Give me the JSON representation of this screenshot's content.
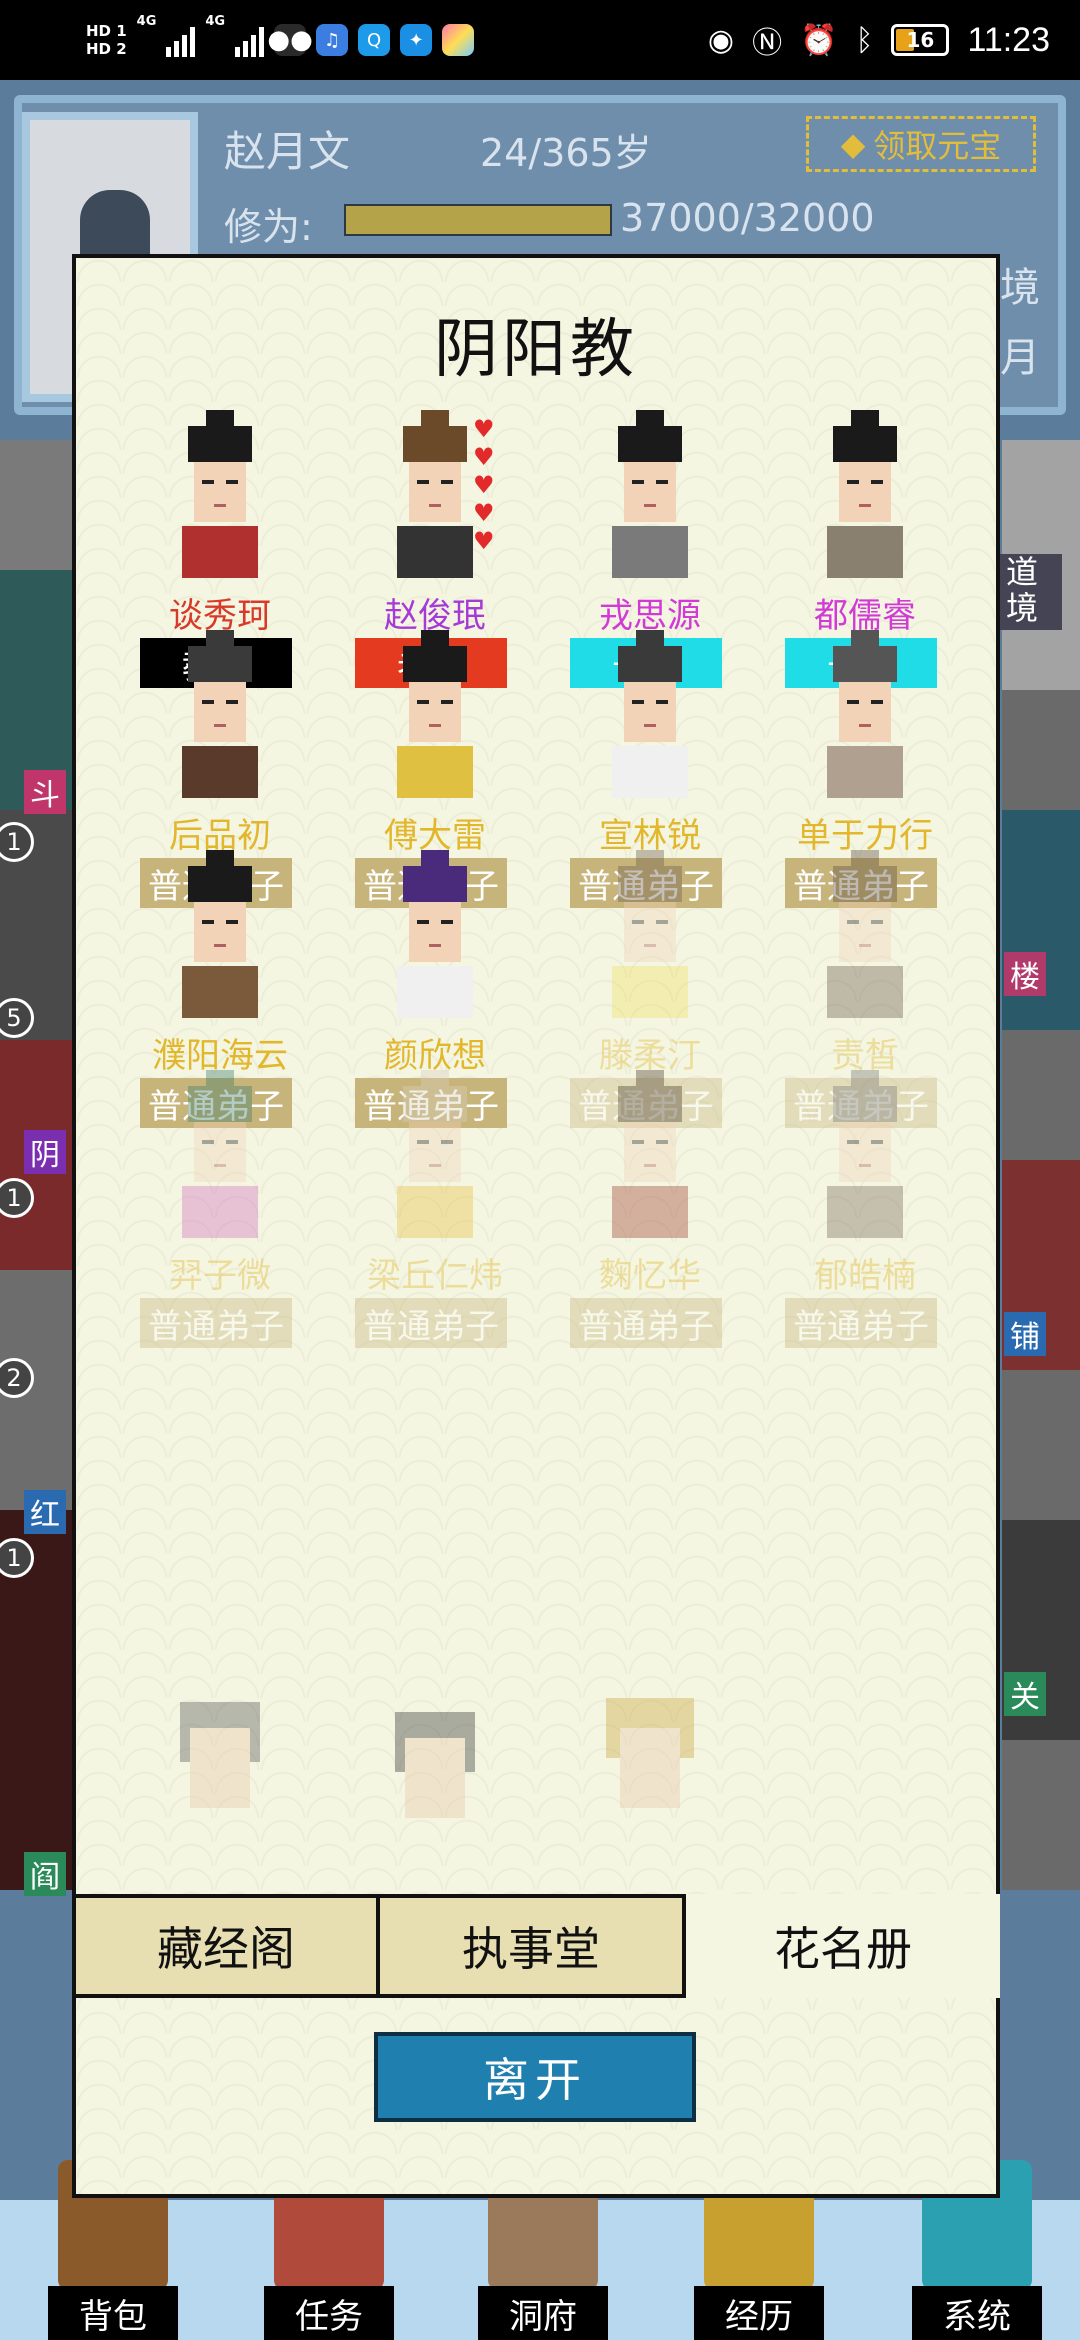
{
  "status_bar": {
    "hd1": "HD 1",
    "hd2": "HD 2",
    "net1": "4G",
    "net2": "4G",
    "battery": "16",
    "time": "11:23",
    "icons": [
      "wechat-icon",
      "music-icon",
      "search-app-icon",
      "bulb-icon",
      "gallery-icon",
      "eye-icon",
      "nfc-icon",
      "alarm-icon",
      "bluetooth-icon"
    ]
  },
  "profile": {
    "name": "赵月文",
    "age": "24/365岁",
    "claim_button": "领取元宝",
    "cultivation_label": "修为:",
    "cultivation_value": "37000/32000",
    "cultivation_fill": 1.0,
    "realm_peek": "境",
    "month_peek": "月"
  },
  "side": {
    "badges": [
      "1",
      "5",
      "1",
      "2",
      "1"
    ],
    "tags_left": [
      "斗",
      "阴",
      "红",
      "阎"
    ],
    "tags_right": [
      "道境",
      "楼",
      "铺",
      "关"
    ]
  },
  "modal": {
    "title": "阴阳教",
    "members": [
      {
        "name": "谈秀珂",
        "rank": "教主",
        "name_color": "#d83a2a",
        "rank_bg": "#000000",
        "dim": false
      },
      {
        "name": "赵俊珉",
        "rank": "老祖",
        "name_color": "#a63ad6",
        "rank_bg": "#e43a20",
        "dim": false,
        "hearts": 5
      },
      {
        "name": "戎思源",
        "rank": "长老",
        "name_color": "#d23ad6",
        "rank_bg": "#1fdce6",
        "dim": false
      },
      {
        "name": "都儒睿",
        "rank": "长老",
        "name_color": "#d23ad6",
        "rank_bg": "#1fdce6",
        "dim": false
      },
      {
        "name": "后品初",
        "rank": "普通弟子",
        "name_color": "#e2b72c",
        "rank_bg": "#c7b47a",
        "dim": false
      },
      {
        "name": "傅大雷",
        "rank": "普通弟子",
        "name_color": "#e2b72c",
        "rank_bg": "#c7b47a",
        "dim": false
      },
      {
        "name": "宣林锐",
        "rank": "普通弟子",
        "name_color": "#e2b72c",
        "rank_bg": "#c7b47a",
        "dim": false
      },
      {
        "name": "单于力行",
        "rank": "普通弟子",
        "name_color": "#e2b72c",
        "rank_bg": "#c7b47a",
        "dim": false
      },
      {
        "name": "濮阳海云",
        "rank": "普通弟子",
        "name_color": "#e2b72c",
        "rank_bg": "#c7b47a",
        "dim": false
      },
      {
        "name": "颜欣想",
        "rank": "普通弟子",
        "name_color": "#e2b72c",
        "rank_bg": "#c7b47a",
        "dim": false
      },
      {
        "name": "滕柔汀",
        "rank": "普通弟子",
        "name_color": "#e2b72c",
        "rank_bg": "#c7b47a",
        "dim": true
      },
      {
        "name": "责皙",
        "rank": "普通弟子",
        "name_color": "#e2b72c",
        "rank_bg": "#c7b47a",
        "dim": true
      },
      {
        "name": "羿子微",
        "rank": "普通弟子",
        "name_color": "#e2b72c",
        "rank_bg": "#c7b47a",
        "dim": true
      },
      {
        "name": "梁丘仁炜",
        "rank": "普通弟子",
        "name_color": "#e2b72c",
        "rank_bg": "#c7b47a",
        "dim": true
      },
      {
        "name": "麴忆华",
        "rank": "普通弟子",
        "name_color": "#e2b72c",
        "rank_bg": "#c7b47a",
        "dim": true
      },
      {
        "name": "郁皓楠",
        "rank": "普通弟子",
        "name_color": "#e2b72c",
        "rank_bg": "#c7b47a",
        "dim": true
      }
    ],
    "tabs": [
      {
        "label": "藏经阁",
        "active": false
      },
      {
        "label": "执事堂",
        "active": false
      },
      {
        "label": "花名册",
        "active": true
      }
    ],
    "leave_button": "离开"
  },
  "bottom_nav": [
    {
      "label": "背包",
      "icon": "backpack-icon"
    },
    {
      "label": "任务",
      "icon": "task-board-icon"
    },
    {
      "label": "洞府",
      "icon": "cave-dwelling-icon"
    },
    {
      "label": "经历",
      "icon": "scroll-book-icon"
    },
    {
      "label": "系统",
      "icon": "system-settings-icon"
    }
  ]
}
